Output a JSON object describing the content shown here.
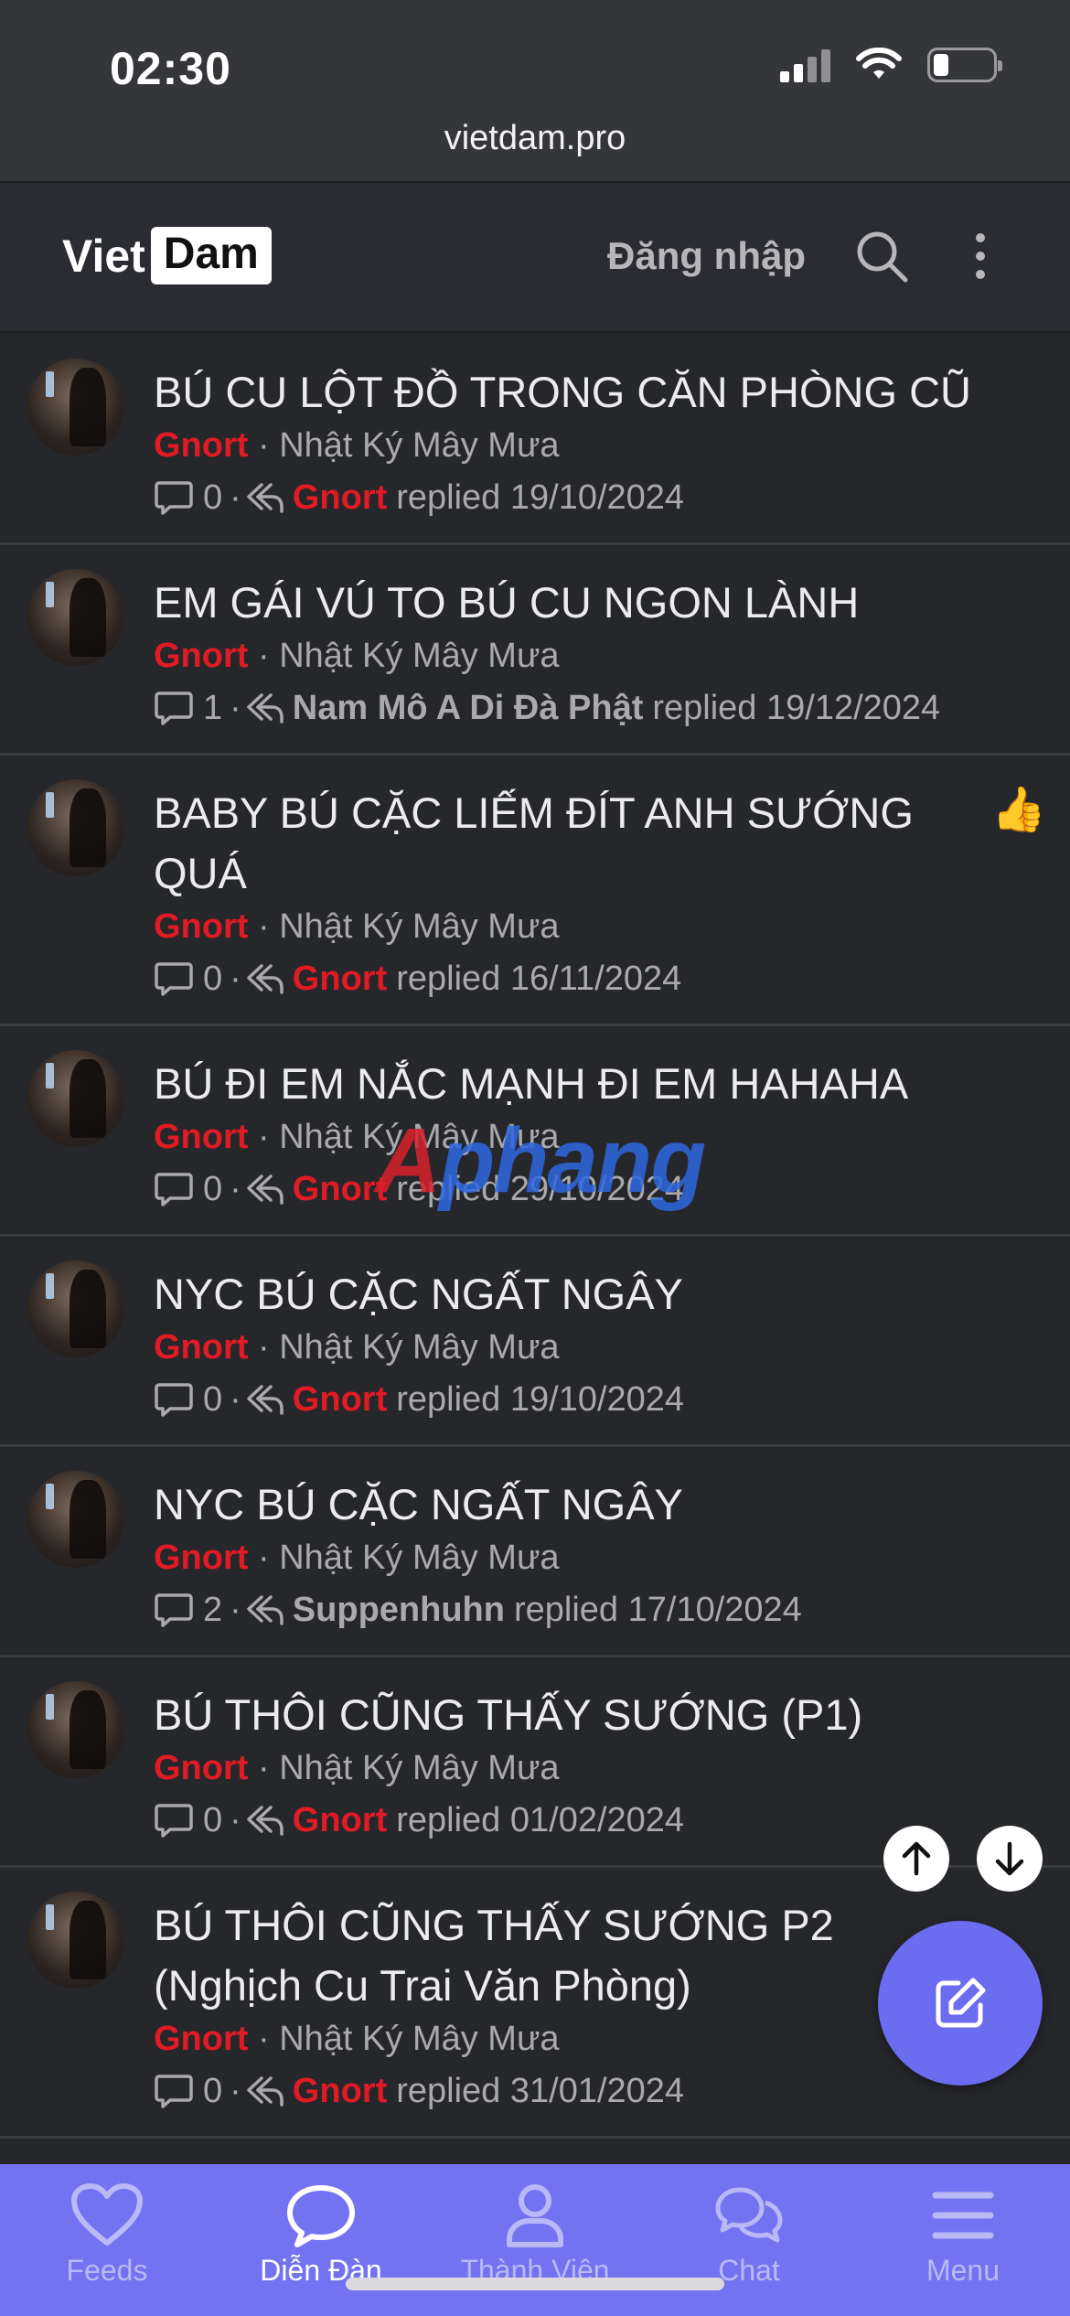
{
  "status_bar": {
    "time": "02:30",
    "url": "vietdam.pro"
  },
  "header": {
    "logo_left": "Viet",
    "logo_right": "Dam",
    "login_label": "Đăng nhập"
  },
  "threads": [
    {
      "title": "BÚ CU LỘT ĐỒ TRONG CĂN PHÒNG CŨ",
      "author": "Gnort",
      "forum": "· Nhật Ký Mây Mưa",
      "replies": "0",
      "last_replier": "Gnort",
      "last_replier_style": "red",
      "replied_text": "replied 19/10/2024",
      "reaction": ""
    },
    {
      "title": "EM GÁI VÚ TO BÚ CU NGON LÀNH",
      "author": "Gnort",
      "forum": "· Nhật Ký Mây Mưa",
      "replies": "1",
      "last_replier": "Nam Mô A Di Đà Phật",
      "last_replier_style": "grey",
      "replied_text": "replied 19/12/2024",
      "reaction": ""
    },
    {
      "title": "BABY BÚ CẶC LIẾM ĐÍT ANH SƯỚNG QUÁ",
      "author": "Gnort",
      "forum": "· Nhật Ký Mây Mưa",
      "replies": "0",
      "last_replier": "Gnort",
      "last_replier_style": "red",
      "replied_text": "replied 16/11/2024",
      "reaction": "👍"
    },
    {
      "title": "BÚ ĐI EM NẮC MẠNH ĐI EM HAHAHA",
      "author": "Gnort",
      "forum": "· Nhật Ký Mây Mưa",
      "replies": "0",
      "last_replier": "Gnort",
      "last_replier_style": "red",
      "replied_text": "replied 29/10/2024",
      "reaction": ""
    },
    {
      "title": "NYC BÚ CẶC NGẤT NGÂY",
      "author": "Gnort",
      "forum": "· Nhật Ký Mây Mưa",
      "replies": "0",
      "last_replier": "Gnort",
      "last_replier_style": "red",
      "replied_text": "replied 19/10/2024",
      "reaction": ""
    },
    {
      "title": "NYC BÚ CẶC NGẤT NGÂY",
      "author": "Gnort",
      "forum": "· Nhật Ký Mây Mưa",
      "replies": "2",
      "last_replier": "Suppenhuhn",
      "last_replier_style": "grey",
      "replied_text": "replied 17/10/2024",
      "reaction": ""
    },
    {
      "title": "BÚ THÔI CŨNG THẤY SƯỚNG (P1)",
      "author": "Gnort",
      "forum": "· Nhật Ký Mây Mưa",
      "replies": "0",
      "last_replier": "Gnort",
      "last_replier_style": "red",
      "replied_text": "replied 01/02/2024",
      "reaction": ""
    },
    {
      "title": "BÚ THÔI CŨNG THẤY SƯỚNG P2 (Nghịch Cu Trai Văn Phòng)",
      "author": "Gnort",
      "forum": "· Nhật Ký Mây Mưa",
      "replies": "0",
      "last_replier": "Gnort",
      "last_replier_style": "red",
      "replied_text": "replied 31/01/2024",
      "reaction": ""
    }
  ],
  "watermark": {
    "first": "A",
    "rest": "phang"
  },
  "bottom_nav": [
    {
      "label": "Feeds",
      "icon": "heart-icon",
      "active": false
    },
    {
      "label": "Diễn Đàn",
      "icon": "chat-bubble-icon",
      "active": true
    },
    {
      "label": "Thành Viên",
      "icon": "user-icon",
      "active": false
    },
    {
      "label": "Chat",
      "icon": "chat-icon",
      "active": false
    },
    {
      "label": "Menu",
      "icon": "menu-icon",
      "active": false
    }
  ],
  "colors": {
    "accent": "#7373f2",
    "author_red": "#e01b24",
    "background": "#26272b"
  }
}
